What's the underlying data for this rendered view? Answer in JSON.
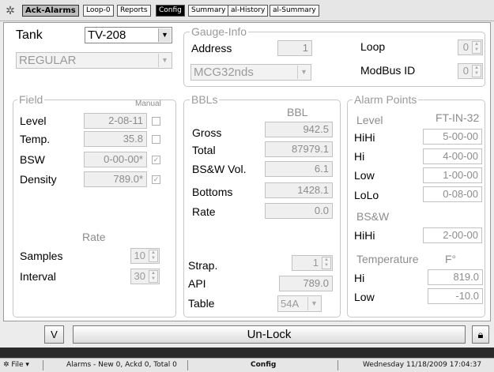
{
  "toolbar": {
    "logo_icon": "app-logo-icon",
    "buttons": [
      "Ack-Alarms",
      "Loop-0",
      "Reports",
      "Config",
      "Summary",
      "al-History",
      "al-Summary"
    ]
  },
  "tank": {
    "label": "Tank",
    "selected": "TV-208",
    "type": "REGULAR"
  },
  "gauge_info": {
    "title": "Gauge-Info",
    "address_label": "Address",
    "address": "1",
    "loop_label": "Loop",
    "loop": "0",
    "model": "MCG32nds",
    "modbus_label": "ModBus ID",
    "modbus": "0"
  },
  "field": {
    "title": "Field",
    "manual_label": "Manual",
    "rows": [
      {
        "label": "Level",
        "value": "2-08-11",
        "checked": false
      },
      {
        "label": "Temp.",
        "value": "35.8",
        "checked": false
      },
      {
        "label": "BSW",
        "value": "0-00-00*",
        "checked": true
      },
      {
        "label": "Density",
        "value": "789.0*",
        "checked": true
      }
    ],
    "rate_label": "Rate",
    "samples_label": "Samples",
    "samples": "10",
    "interval_label": "Interval",
    "interval": "30"
  },
  "bbls": {
    "title": "BBLs",
    "unit": "BBL",
    "rows": [
      {
        "label": "Gross",
        "value": "942.5"
      },
      {
        "label": "Total",
        "value": "87979.1"
      },
      {
        "label": "BS&W Vol.",
        "value": "6.1"
      },
      {
        "label": "Bottoms",
        "value": "1428.1"
      },
      {
        "label": "Rate",
        "value": "0.0"
      }
    ],
    "strap_label": "Strap.",
    "strap": "1",
    "api_label": "API",
    "api": "789.0",
    "table_label": "Table",
    "table": "54A"
  },
  "alarm_points": {
    "title": "Alarm Points",
    "level_label": "Level",
    "level_unit": "FT-IN-32",
    "level_rows": [
      {
        "label": "HiHi",
        "value": "5-00-00"
      },
      {
        "label": "Hi",
        "value": "4-00-00"
      },
      {
        "label": "Low",
        "value": "1-00-00"
      },
      {
        "label": "LoLo",
        "value": "0-08-00"
      }
    ],
    "bsw_label": "BS&W",
    "bsw_hihi_label": "HiHi",
    "bsw_hihi": "2-00-00",
    "temp_label": "Temperature",
    "temp_unit": "F°",
    "temp_hi_label": "Hi",
    "temp_hi": "819.0",
    "temp_low_label": "Low",
    "temp_low": "-10.0"
  },
  "bottom": {
    "v_label": "V",
    "unlock_label": "Un-Lock",
    "lock_icon": "lock-icon"
  },
  "status": {
    "file_label": "File",
    "alarms": "Alarms - New 0, Ackd 0, Total 0",
    "mode": "Config",
    "datetime": "Wednesday 11/18/2009 17:04:37"
  }
}
